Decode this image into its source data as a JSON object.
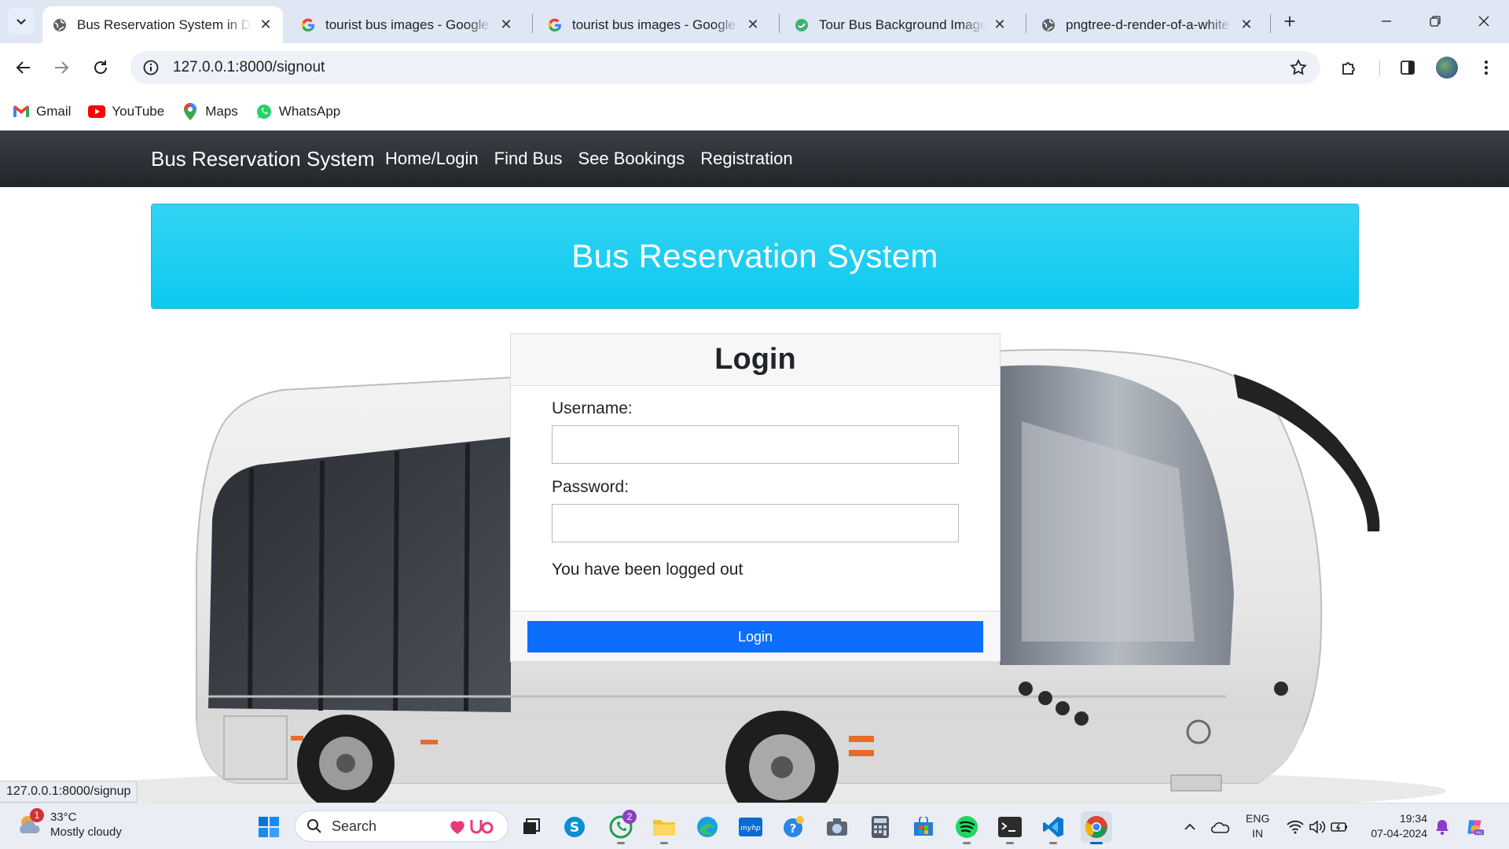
{
  "browser": {
    "tabs": [
      {
        "title": "Bus Reservation System in Django",
        "active": true,
        "favicon": "globe-icon"
      },
      {
        "title": "tourist bus images - Google Search",
        "active": false,
        "favicon": "google-icon"
      },
      {
        "title": "tourist bus images - Google Search",
        "active": false,
        "favicon": "google-icon"
      },
      {
        "title": "Tour Bus Background Images",
        "active": false,
        "favicon": "green-circle-icon"
      },
      {
        "title": "pngtree-d-render-of-a-white",
        "active": false,
        "favicon": "globe-icon"
      }
    ],
    "url": "127.0.0.1:8000/signout",
    "bookmarks": [
      {
        "label": "Gmail",
        "icon": "gmail-icon"
      },
      {
        "label": "YouTube",
        "icon": "youtube-icon"
      },
      {
        "label": "Maps",
        "icon": "maps-icon"
      },
      {
        "label": "WhatsApp",
        "icon": "whatsapp-icon"
      }
    ],
    "status_url": "127.0.0.1:8000/signup"
  },
  "page": {
    "navbar": {
      "brand": "Bus Reservation System",
      "links": [
        "Home/Login",
        "Find Bus",
        "See Bookings",
        "Registration"
      ]
    },
    "jumbotron": {
      "title": "Bus Reservation System"
    },
    "login": {
      "title": "Login",
      "username_label": "Username:",
      "username_value": "",
      "password_label": "Password:",
      "password_value": "",
      "message": "You have been logged out",
      "button": "Login"
    }
  },
  "taskbar": {
    "weather": {
      "temp": "33°C",
      "desc": "Mostly cloudy",
      "badge": "1"
    },
    "search_label": "Search",
    "whatsapp_badge": "2",
    "lang": {
      "line1": "ENG",
      "line2": "IN"
    },
    "clock": {
      "time": "19:34",
      "date": "07-04-2024"
    }
  },
  "colors": {
    "navbar": "#212529",
    "jumbotron": "#0dcaf0",
    "primary_button": "#0d6efd"
  }
}
